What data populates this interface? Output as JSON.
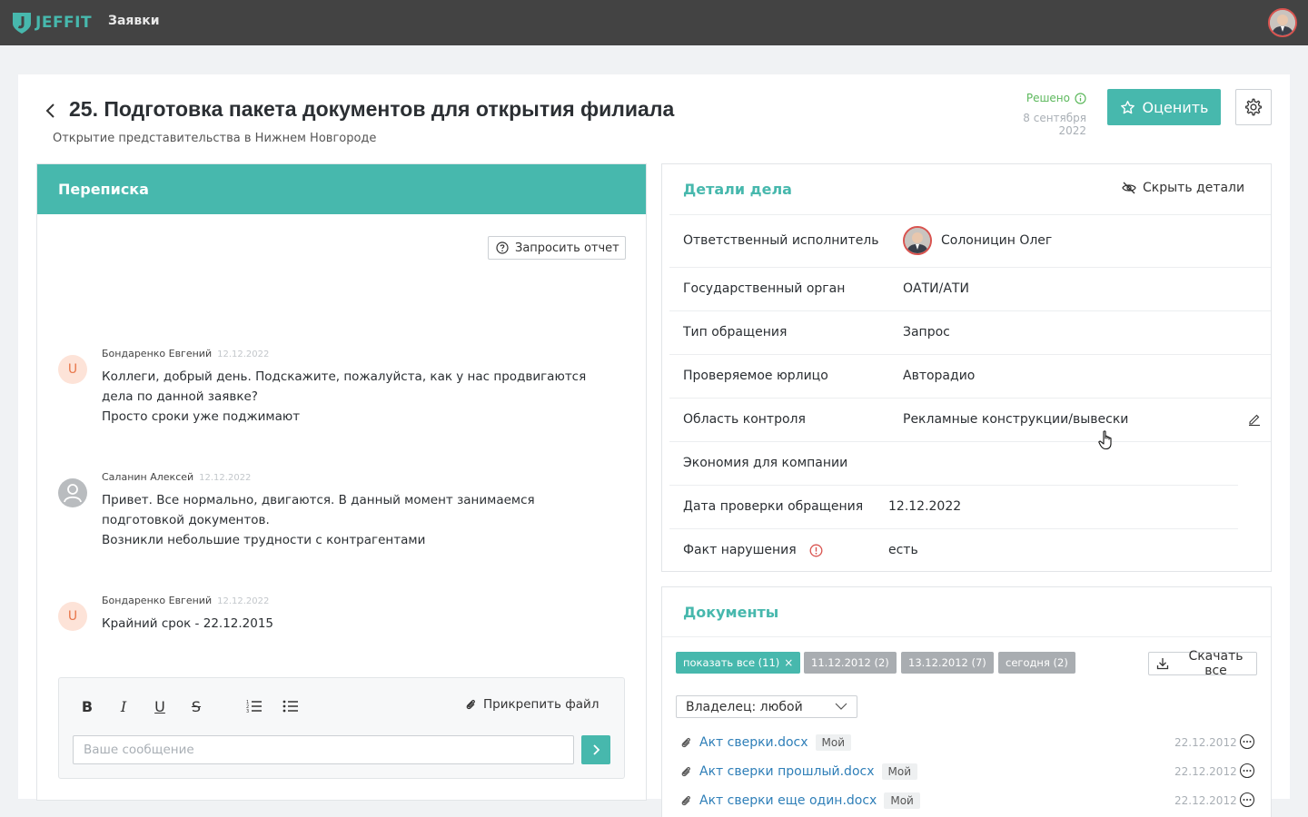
{
  "app": {
    "brand": "JEFFIT",
    "nav_link": "Заявки",
    "accent": "#47b8ad"
  },
  "page": {
    "title": "25. Подготовка пакета документов для открытия филиала",
    "subtitle": "Открытие представительства в Нижнем Новгороде",
    "status": "Решено",
    "status_date": "8 сентября 2022",
    "rate_button": "Оценить"
  },
  "chat": {
    "title": "Переписка",
    "request_report": "Запросить отчет",
    "messages": [
      {
        "author": "Бондаренко Евгений",
        "date": "12.12.2022",
        "avatar_letter": "U",
        "lines": [
          "Коллеги, добрый день. Подскажите, пожалуйста, как у нас продвигаются",
          "дела по данной заявке?",
          "Просто сроки уже поджимают"
        ]
      },
      {
        "author": "Саланин Алексей",
        "date": "12.12.2022",
        "avatar_letter": "",
        "lines": [
          "Привет. Все нормально, двигаются. В данный момент занимаемся",
          "подготовкой документов.",
          "Возникли небольшие трудности с контрагентами"
        ]
      },
      {
        "author": "Бондаренко Евгений",
        "date": "12.12.2022",
        "avatar_letter": "U",
        "lines": [
          "Крайний срок - 22.12.2015"
        ]
      }
    ],
    "composer": {
      "bold": "B",
      "italic": "I",
      "underline": "U",
      "strike": "S",
      "attach": "Прикрепить файл",
      "placeholder": "Ваше сообщение"
    }
  },
  "details": {
    "title": "Детали дела",
    "hide_button": "Скрыть детали",
    "rows": [
      {
        "label": "Ответственный исполнитель",
        "value": "Солоницин Олег"
      },
      {
        "label": "Государственный орган",
        "value": "ОАТИ/АТИ"
      },
      {
        "label": "Тип обращения",
        "value": "Запрос"
      },
      {
        "label": "Проверяемое юрлицо",
        "value": "Авторадио"
      },
      {
        "label": "Область контроля",
        "value": "Рекламные конструкции/вывески"
      },
      {
        "label": "Экономия для компании",
        "value": ""
      },
      {
        "label": "Дата проверки обращения",
        "value": "12.12.2022"
      },
      {
        "label": "Факт нарушения",
        "value": "есть"
      }
    ]
  },
  "documents": {
    "title": "Документы",
    "filters": [
      "показать все (11)",
      "11.12.2012 (2)",
      "13.12.2012 (7)",
      "сегодня (2)"
    ],
    "download_all": "Скачать все",
    "owner_filter": "Владелец: любой",
    "files": [
      {
        "name": "Акт сверки.docx",
        "tag": "Мой",
        "date": "22.12.2012"
      },
      {
        "name": "Акт сверки прошлый.docx",
        "tag": "Мой",
        "date": "22.12.2012"
      },
      {
        "name": "Акт сверки еще один.docx",
        "tag": "Мой",
        "date": "22.12.2012"
      }
    ]
  }
}
